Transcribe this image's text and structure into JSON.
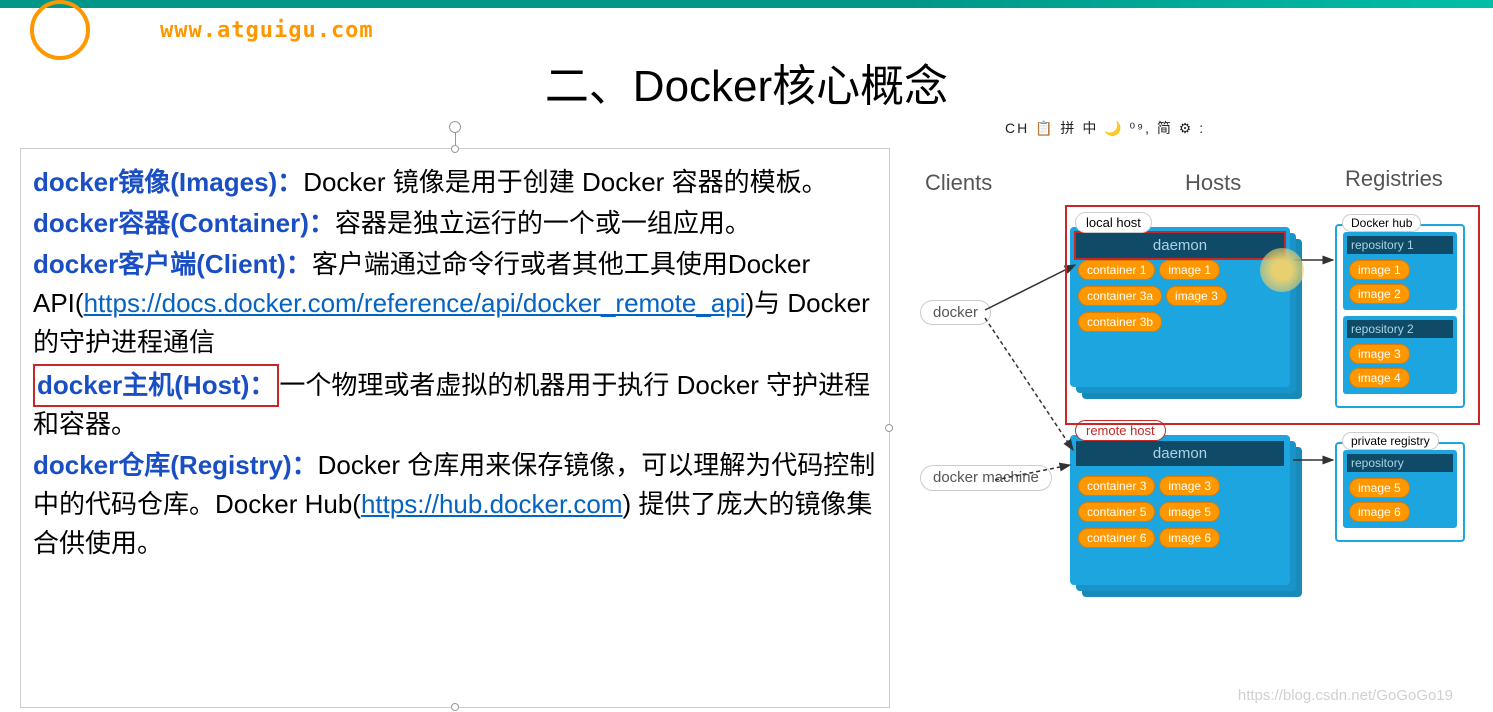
{
  "site_url": "www.atguigu.com",
  "title": "二、Docker核心概念",
  "ime_bar": "CH 📋 拼 中 🌙 ⁰⁹, 简 ⚙ :",
  "definitions": {
    "images": {
      "term": "docker镜像(Images)：",
      "text": "Docker 镜像是用于创建 Docker 容器的模板。"
    },
    "container": {
      "term": "docker容器(Container)：",
      "text": "容器是独立运行的一个或一组应用。"
    },
    "client": {
      "term": "docker客户端(Client)：",
      "text_pre": "客户端通过命令行或者其他工具使用Docker API(",
      "link": "https://docs.docker.com/reference/api/docker_remote_api",
      "text_post": ")与 Docker 的守护进程通信"
    },
    "host": {
      "term": "docker主机(Host)：",
      "text": "一个物理或者虚拟的机器用于执行 Docker 守护进程和容器。"
    },
    "registry": {
      "term": "docker仓库(Registry)：",
      "text_pre": "Docker 仓库用来保存镜像，可以理解为代码控制中的代码仓库。Docker Hub(",
      "link": "https://hub.docker.com",
      "text_post": ") 提供了庞大的镜像集合供使用。"
    }
  },
  "diagram": {
    "headers": {
      "clients": "Clients",
      "hosts": "Hosts",
      "registries": "Registries"
    },
    "clients": {
      "docker": "docker",
      "machine": "docker machine"
    },
    "local_host": {
      "label": "local host",
      "daemon": "daemon",
      "containers": [
        "container 1",
        "container 3a",
        "container 3b"
      ],
      "images": [
        "image 1",
        "image 3"
      ]
    },
    "remote_host": {
      "label": "remote host",
      "daemon": "daemon",
      "containers": [
        "container 3",
        "container 5",
        "container 6"
      ],
      "images": [
        "image 3",
        "image 5",
        "image 6"
      ]
    },
    "docker_hub": {
      "label": "Docker hub",
      "repo1": {
        "title": "repository 1",
        "images": [
          "image 1",
          "image 2"
        ]
      },
      "repo2": {
        "title": "repository 2",
        "images": [
          "image 3",
          "image 4"
        ]
      }
    },
    "private_registry": {
      "label": "private registry",
      "repo": {
        "title": "repository",
        "images": [
          "image 5",
          "image 6"
        ]
      }
    }
  },
  "watermark": "https://blog.csdn.net/GoGoGo19"
}
